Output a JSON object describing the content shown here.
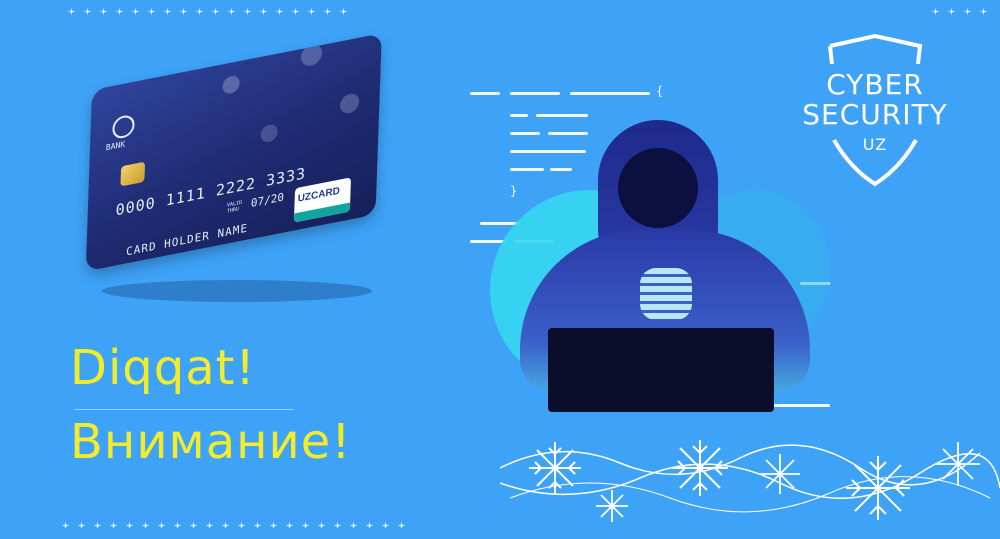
{
  "headline": {
    "latin": "Diqqat!",
    "cyrillic": "Внимание!"
  },
  "badge": {
    "line1": "CYBER",
    "line2": "SECURITY",
    "line3": "UZ"
  },
  "card": {
    "bank_label": "BANK",
    "number": "0000 1111 2222 3333",
    "valid_thru_label": "VALID THRU",
    "expiry": "07/20",
    "holder": "CARD HOLDER NAME",
    "brand": "UZCARD"
  },
  "code_braces": {
    "open": "{",
    "close": "}"
  },
  "colors": {
    "background": "#3ea2f7",
    "headline": "#f3ec2a",
    "card": "#1f2f7a",
    "hacker": "#2a3aa8",
    "laptop": "#0b0e2a",
    "glow": "#36d6ef"
  }
}
